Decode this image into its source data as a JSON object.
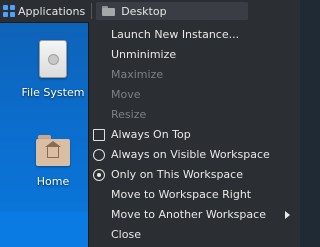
{
  "panel": {
    "applications_label": "Applications",
    "task_label": "Desktop"
  },
  "desktop": {
    "icons": [
      {
        "label": "File System",
        "icon": "drive-icon"
      },
      {
        "label": "Home",
        "icon": "home-folder-icon"
      }
    ]
  },
  "menu": {
    "items": [
      {
        "label": "Launch New Instance...",
        "state": "enabled"
      },
      {
        "label": "Unminimize",
        "state": "enabled"
      },
      {
        "label": "Maximize",
        "state": "disabled"
      },
      {
        "label": "Move",
        "state": "disabled"
      },
      {
        "label": "Resize",
        "state": "disabled"
      },
      {
        "label": "Always On Top",
        "state": "enabled",
        "control": "checkbox",
        "checked": false
      },
      {
        "label": "Always on Visible Workspace",
        "state": "enabled",
        "control": "radio",
        "checked": false
      },
      {
        "label": "Only on This Workspace",
        "state": "enabled",
        "control": "radio",
        "checked": true
      },
      {
        "label": "Move to Workspace Right",
        "state": "enabled"
      },
      {
        "label": "Move to Another Workspace",
        "state": "enabled",
        "submenu": true
      },
      {
        "label": "Close",
        "state": "enabled"
      }
    ]
  },
  "colors": {
    "panel_bg": "#2b2e33",
    "menu_bg": "#2b2e33",
    "desktop_blue": "#0b6fd0",
    "text": "#e8e8e8",
    "disabled_text": "#7d8187"
  }
}
